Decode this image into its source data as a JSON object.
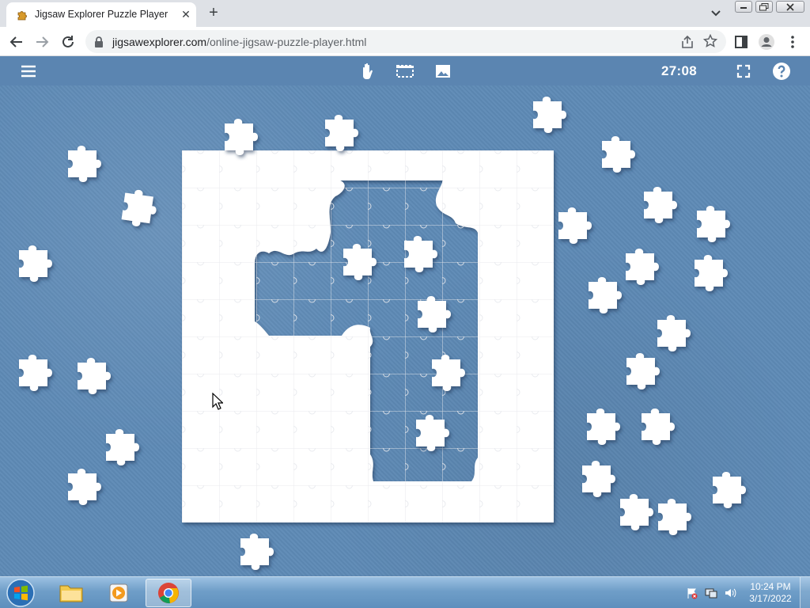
{
  "browser": {
    "tab_title": "Jigsaw Explorer Puzzle Player",
    "url_host": "jigsawexplorer.com",
    "url_path": "/online-jigsaw-puzzle-player.html"
  },
  "app_toolbar": {
    "timer": "27:08"
  },
  "taskbar": {
    "time": "10:24 PM",
    "date": "3/17/2022"
  },
  "icons": {
    "tab": [
      "favicon-icon",
      "close-icon",
      "plus-icon",
      "chevron-down-icon"
    ],
    "nav": [
      "back-icon",
      "forward-icon",
      "reload-icon",
      "lock-icon",
      "share-icon",
      "star-icon",
      "side-panel-icon",
      "profile-icon",
      "kebab-menu-icon"
    ],
    "toolbar": [
      "hamburger-icon",
      "hand-icon",
      "select-box-icon",
      "image-icon",
      "fullscreen-icon",
      "help-icon"
    ]
  },
  "colors": {
    "toolbar": "#5b85b1",
    "table": "#5e8ab6",
    "piece": "#ffffff"
  }
}
